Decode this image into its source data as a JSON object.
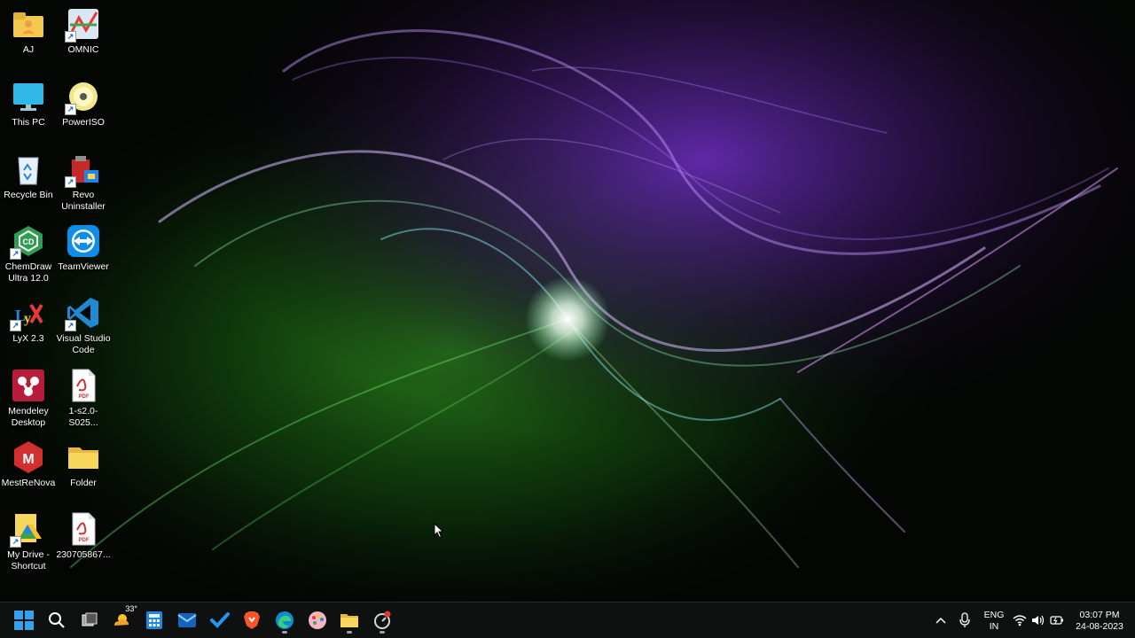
{
  "desktop": {
    "icons": [
      {
        "label": "AJ"
      },
      {
        "label": "OMNIC"
      },
      {
        "label": "This PC"
      },
      {
        "label": "PowerISO"
      },
      {
        "label": "Recycle Bin"
      },
      {
        "label": "Revo\nUninstaller"
      },
      {
        "label": "ChemDraw\nUltra 12.0"
      },
      {
        "label": "TeamViewer"
      },
      {
        "label": "LyX 2.3"
      },
      {
        "label": "Visual Studio\nCode"
      },
      {
        "label": "Mendeley\nDesktop"
      },
      {
        "label": "1-s2.0-S025..."
      },
      {
        "label": "MestReNova"
      },
      {
        "label": "Folder"
      },
      {
        "label": "My Drive -\nShortcut"
      },
      {
        "label": "230705867..."
      }
    ]
  },
  "taskbar": {
    "weather_temp": "33°",
    "tray": {
      "language": "ENG",
      "region": "IN",
      "time": "03:07 PM",
      "date": "24-08-2023"
    }
  },
  "colors": {
    "accent_blue": "#1e88e5",
    "taskbar_bg": "#101212",
    "wall_purple": "#9c4dff",
    "wall_green": "#3ecf3a"
  }
}
